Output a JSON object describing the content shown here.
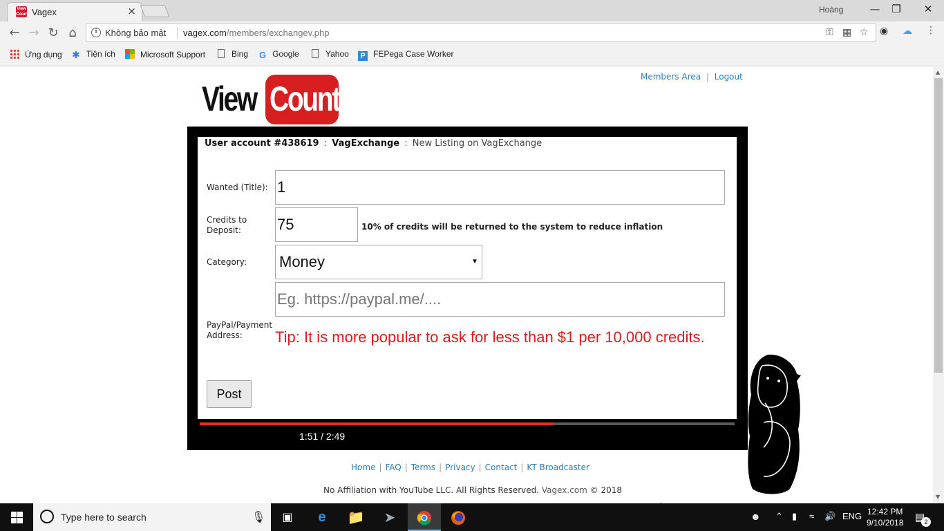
{
  "browser": {
    "tab_title": "Vagex",
    "tab_favicon_text": "View\nCount",
    "tab_close": "×",
    "profile_name": "Hoàng",
    "security_label": "Không bảo mật",
    "url_host": "vagex.com",
    "url_path": "/members/exchangev.php",
    "bookmarks": [
      {
        "label": "Ứng dụng",
        "icon": "apps-grid-icon"
      },
      {
        "label": "Tiện ích",
        "icon": "puzzle-icon"
      },
      {
        "label": "Microsoft Support",
        "icon": "microsoft-icon"
      },
      {
        "label": "Bing",
        "icon": "page-icon"
      },
      {
        "label": "Google",
        "icon": "google-icon"
      },
      {
        "label": "Yahoo",
        "icon": "page-icon"
      },
      {
        "label": "FEPega Case Worker",
        "icon": "pega-icon"
      }
    ]
  },
  "site": {
    "logo_view": "View",
    "logo_count": "Count",
    "nav": {
      "members_area": "Members Area",
      "logout": "Logout",
      "separator": "|"
    }
  },
  "breadcrumb": {
    "account": "User account #438619",
    "section": "VagExchange",
    "page": "New Listing on VagExchange",
    "separator": ":"
  },
  "form": {
    "title_label": "Wanted (Title):",
    "title_value": "1",
    "credits_label": "Credits to Deposit:",
    "credits_value": "75",
    "credits_note": "10% of credits will be returned to the system to reduce inflation",
    "category_label": "Category:",
    "category_value": "Money",
    "payment_label": "PayPal/Payment Address:",
    "payment_placeholder": "Eg. https://paypal.me/....",
    "tip": "Tip: It is more popular to ask for less than $1 per 10,000 credits.",
    "post_button": "Post"
  },
  "player": {
    "elapsed": "1:51",
    "duration": "2:49",
    "time_display": "1:51 / 2:49",
    "progress_fraction": 0.66
  },
  "footer": {
    "links": [
      "Home",
      "FAQ",
      "Terms",
      "Privacy",
      "Contact",
      "KT Broadcaster"
    ],
    "copyright_prefix": "No Affiliation with YouTube LLC. All Rights Reserved.",
    "copyright_brand": "Vagex.com",
    "copyright_suffix": "© 2018"
  },
  "taskbar": {
    "search_placeholder": "Type here to search",
    "language": "ENG",
    "time": "12:42 PM",
    "date": "9/10/2018",
    "notification_count": "2"
  },
  "colors": {
    "brand_red": "#d71f1f",
    "link_blue": "#2a7fb8",
    "tip_red": "#e01b1b",
    "progress_red": "#e52d27"
  }
}
